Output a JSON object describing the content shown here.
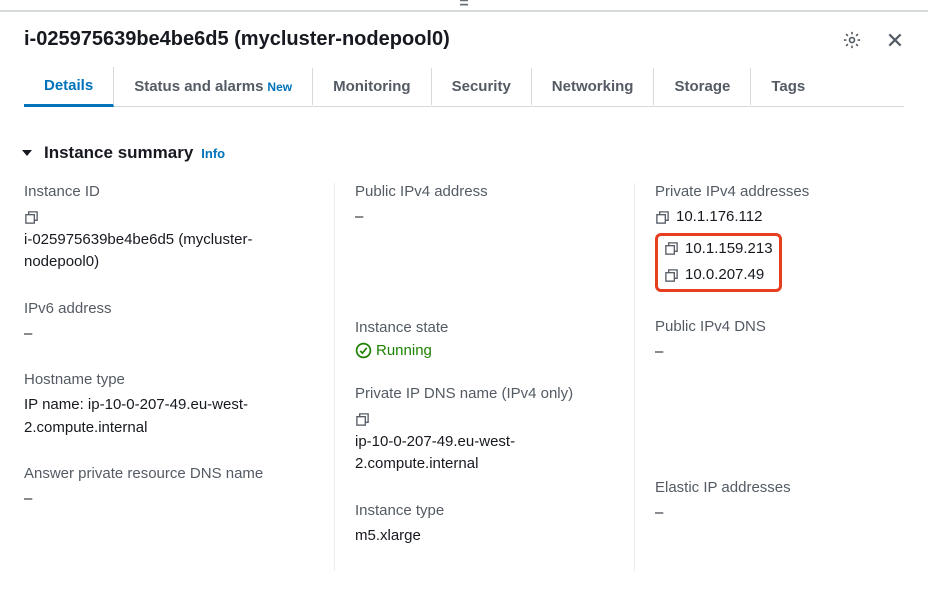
{
  "header": {
    "title": "i-025975639be4be6d5 (mycluster-nodepool0)"
  },
  "tabs": {
    "details": "Details",
    "status_alarms": "Status and alarms",
    "status_badge": "New",
    "monitoring": "Monitoring",
    "security": "Security",
    "networking": "Networking",
    "storage": "Storage",
    "tags": "Tags"
  },
  "section": {
    "title": "Instance summary",
    "info": "Info"
  },
  "fields": {
    "instance_id_label": "Instance ID",
    "instance_id_value": "i-025975639be4be6d5 (mycluster-nodepool0)",
    "public_ipv4_label": "Public IPv4 address",
    "public_ipv4_value": "–",
    "private_ipv4_label": "Private IPv4 addresses",
    "private_ipv4_1": "10.1.176.112",
    "private_ipv4_2": "10.1.159.213",
    "private_ipv4_3": "10.0.207.49",
    "ipv6_label": "IPv6 address",
    "ipv6_value": "–",
    "instance_state_label": "Instance state",
    "instance_state_value": "Running",
    "public_dns_label": "Public IPv4 DNS",
    "public_dns_value": "–",
    "hostname_type_label": "Hostname type",
    "hostname_type_value": "IP name: ip-10-0-207-49.eu-west-2.compute.internal",
    "private_dns_label": "Private IP DNS name (IPv4 only)",
    "private_dns_value": "ip-10-0-207-49.eu-west-2.compute.internal",
    "answer_dns_label": "Answer private resource DNS name",
    "answer_dns_value": "–",
    "instance_type_label": "Instance type",
    "instance_type_value": "m5.xlarge",
    "elastic_ip_label": "Elastic IP addresses",
    "elastic_ip_value": "–"
  }
}
